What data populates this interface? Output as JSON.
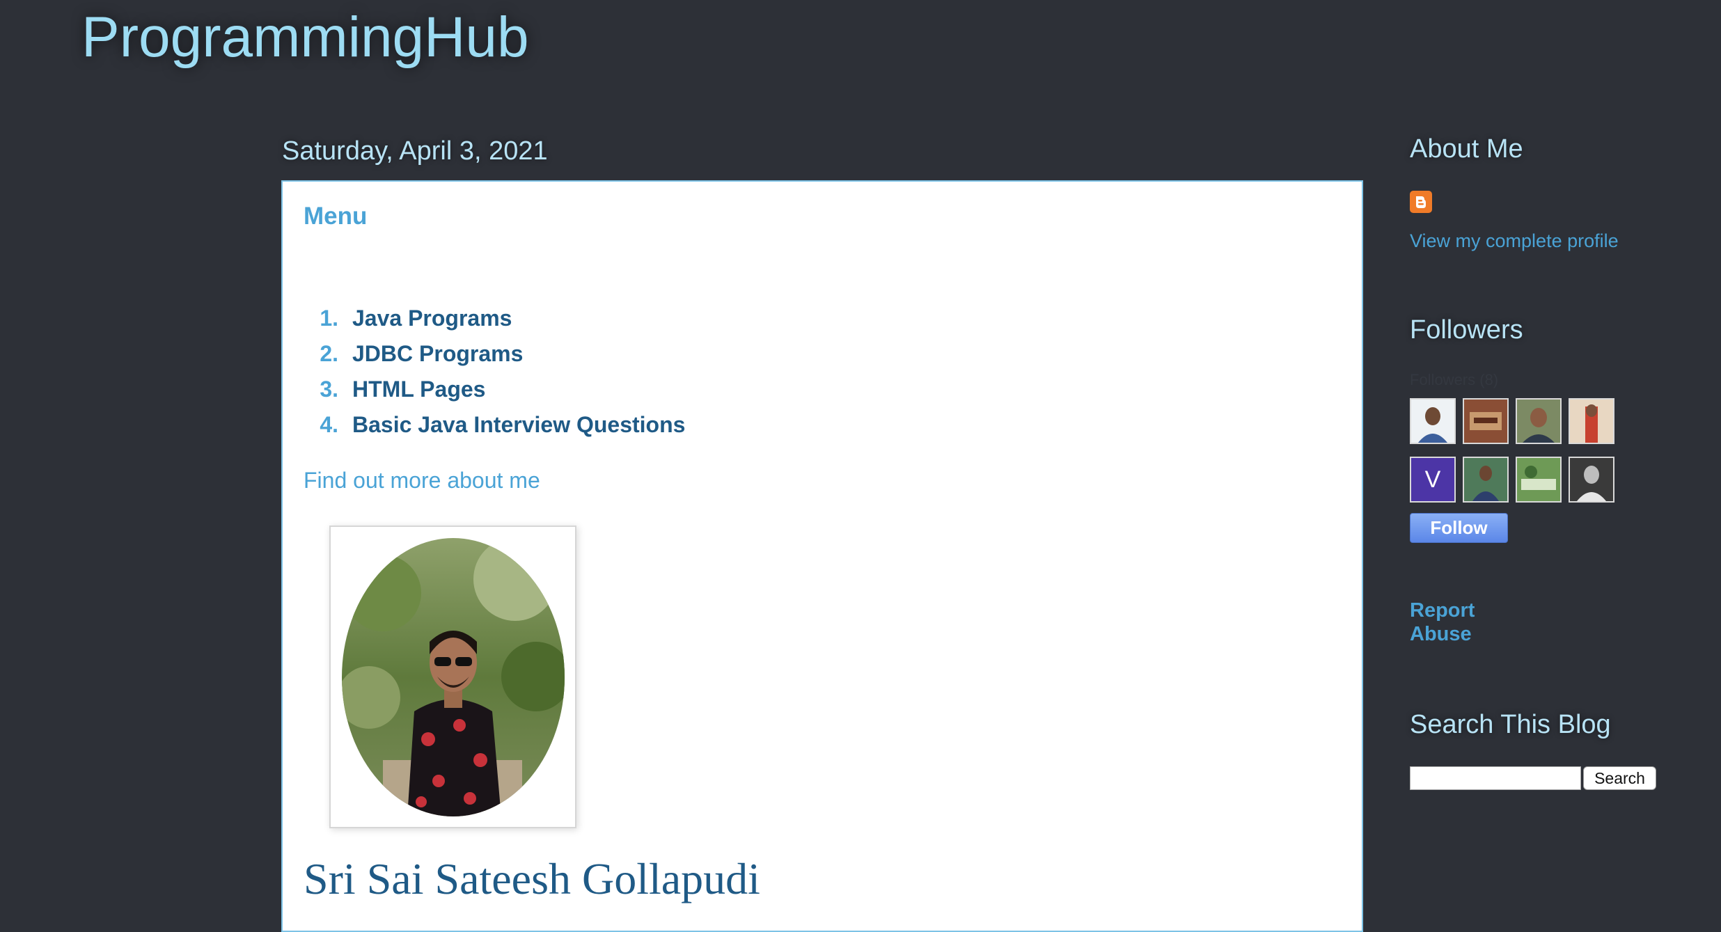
{
  "site": {
    "title": "ProgrammingHub"
  },
  "post": {
    "date": "Saturday, April 3, 2021",
    "title": "Menu",
    "menu": [
      {
        "num": "1.",
        "label": "Java Programs"
      },
      {
        "num": "2.",
        "label": "JDBC Programs"
      },
      {
        "num": "3.",
        "label": "HTML Pages"
      },
      {
        "num": "4.",
        "label": "Basic Java Interview Questions"
      }
    ],
    "more_link": "Find out more about me",
    "author_name": "Sri Sai Sateesh Gollapudi"
  },
  "sidebar": {
    "about_heading": "About Me",
    "profile_link": "View my complete profile",
    "followers_heading": "Followers",
    "followers_caption": "Followers (8)",
    "follower_initial": "V",
    "follow_label": "Follow",
    "report_line1": "Report",
    "report_line2": "Abuse",
    "search_heading": "Search This Blog",
    "search_button": "Search"
  },
  "colors": {
    "background": "#2d3037",
    "title": "#9ddcf3",
    "link": "#4aa3d6",
    "accent_orange": "#f07b28",
    "follow_button": "#5b87e8"
  }
}
